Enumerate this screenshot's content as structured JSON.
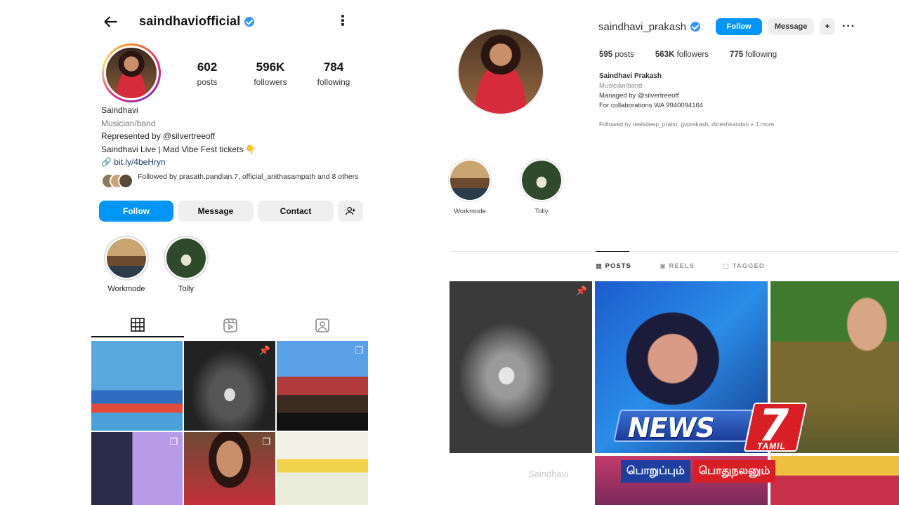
{
  "mobile": {
    "username": "saindhaviofficial",
    "stats": [
      {
        "value": "602",
        "label": "posts"
      },
      {
        "value": "596K",
        "label": "followers"
      },
      {
        "value": "784",
        "label": "following"
      }
    ],
    "bio": {
      "name": "Saindhavi",
      "category": "Musician/band",
      "represented": "Represented by @silvertreeoff",
      "live": "Saindhavi Live | Mad Vibe Fest tickets 👇",
      "link": "bit.ly/4beHryn"
    },
    "followed_by": "Followed by prasath.pandian.7, official_anithasampath and 8 others",
    "buttons": {
      "follow": "Follow",
      "message": "Message",
      "contact": "Contact"
    },
    "highlights": [
      {
        "label": "Workmode"
      },
      {
        "label": "Tolly"
      }
    ]
  },
  "desktop": {
    "username": "saindhavi_prakash",
    "buttons": {
      "follow": "Follow",
      "message": "Message"
    },
    "stats": {
      "posts": "595",
      "posts_label": "posts",
      "followers": "563K",
      "followers_label": "followers",
      "following": "775",
      "following_label": "following"
    },
    "bio": {
      "name": "Saindhavi Prakash",
      "category": "Musician/band",
      "managed": "Managed by @silvertreeoff",
      "contact": "For collaborations WA 9940094164"
    },
    "followed_by": "Followed by realsdeep_prabu, gvprakash, dineshkandan + 1 more",
    "highlights": [
      {
        "label": "Workmode"
      },
      {
        "label": "Tolly"
      }
    ],
    "tabs": [
      "POSTS",
      "REELS",
      "TAGGED"
    ],
    "faint_text": "Saindhavi"
  },
  "overlay": {
    "logo_word": "NEWS",
    "logo_number": "7",
    "logo_sub": "TAMIL",
    "tagline_a": "பொறுப்பும்",
    "tagline_b": "பொதுநலனும்"
  },
  "colors": {
    "accent_blue": "#0095f6",
    "verified": "#3797f0",
    "news_red": "#d81f26",
    "news_blue": "#1e3f9e"
  }
}
